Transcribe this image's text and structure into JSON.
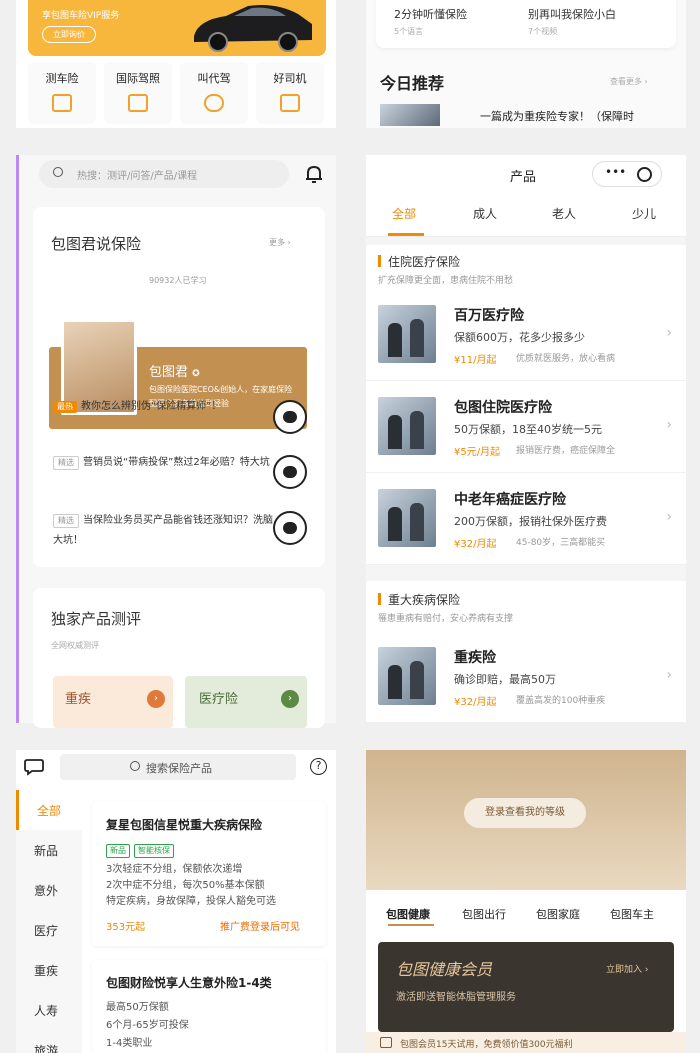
{
  "panel1": {
    "banner_subtitle": "享包图车险VIP服务",
    "banner_button": "立即询价",
    "services": [
      "测车险",
      "国际驾照",
      "叫代驾",
      "好司机"
    ]
  },
  "panel2": {
    "videos": [
      {
        "title": "2分钟听懂保险",
        "count": "5个语言"
      },
      {
        "title": "别再叫我保险小白",
        "count": "7个视频"
      }
    ],
    "recommend_title": "今日推荐",
    "see_more": "查看更多",
    "recommend_item": "一篇成为重疾险专家！（保障时"
  },
  "panel3": {
    "search_placeholder": "热搜：测评/问答/产品/课程",
    "section_title": "包图君说保险",
    "more": "更多",
    "learners": "90932人已学习",
    "author": "包图君",
    "author_desc": "包图保险医院CEO&创始人，在家庭保险配置方面有着独到经验",
    "questions": [
      {
        "tag": "最热",
        "text": "教你怎么辨别伪“保险精算师”！"
      },
      {
        "tag": "精选",
        "text": "营销员说“带病投保”熬过2年必赔？特大坑"
      },
      {
        "tag": "精选",
        "text": "当保险业务员买产品能省钱还涨知识？洗脑大坑！"
      }
    ],
    "review_title": "独家产品测评",
    "review_sub": "全网权威测评",
    "review_cards": [
      "重疾",
      "医疗险"
    ]
  },
  "panel4": {
    "title": "产品",
    "tabs": [
      "全部",
      "成人",
      "老人",
      "少儿"
    ],
    "section1": {
      "title": "住院医疗保险",
      "sub": "扩充保障更全面，患病住院不用愁"
    },
    "section2": {
      "title": "重大疾病保险",
      "sub": "罹患重病有赔付，安心养病有支撑"
    },
    "products": [
      {
        "name": "百万医疗险",
        "desc": "保额600万，花多少报多少",
        "price": "¥11/月起",
        "meta": "优质就医服务，放心看病"
      },
      {
        "name": "包图住院医疗险",
        "desc": "50万保额，18至40岁统一5元",
        "price": "¥5元/月起",
        "meta": "报销医疗费，癌症保障全"
      },
      {
        "name": "中老年癌症医疗险",
        "desc": "200万保额，报销社保外医疗费",
        "price": "¥32/月起",
        "meta": "45-80岁，三高都能买"
      },
      {
        "name": "重疾险",
        "desc": "确诊即赔，最高50万",
        "price": "¥32/月起",
        "meta": "覆盖高发的100种重疾"
      }
    ]
  },
  "panel5": {
    "search_placeholder": "搜索保险产品",
    "categories": [
      "全部",
      "新品",
      "意外",
      "医疗",
      "重疾",
      "人寿",
      "旅游"
    ],
    "card1": {
      "title": "复星包图信星悦重大疾病保险",
      "tags": [
        "新品",
        "智能核保"
      ],
      "lines": [
        "3次轻症不分组，保额依次递增",
        "2次中症不分组，每次50%基本保额",
        "特定疾病，身故保障，投保人豁免可选"
      ],
      "price": "353元起",
      "promo": "推广费登录后可见"
    },
    "card2": {
      "title": "包图财险悦享人生意外险1-4类",
      "lines": [
        "最高50万保额",
        "6个月-65岁可投保",
        "1-4类职业"
      ]
    }
  },
  "panel6": {
    "level_button": "登录查看我的等级",
    "tabs": [
      "包图健康",
      "包图出行",
      "包图家庭",
      "包图车主"
    ],
    "vip_title": "包图健康会员",
    "vip_join": "立即加入",
    "vip_sub": "激活即送智能体脂管理服务",
    "footer": "包图会员15天试用，免费领价值300元福利"
  },
  "colors": {
    "accent": "#f08a00",
    "gold": "#c29051",
    "dark": "#3b3530"
  }
}
